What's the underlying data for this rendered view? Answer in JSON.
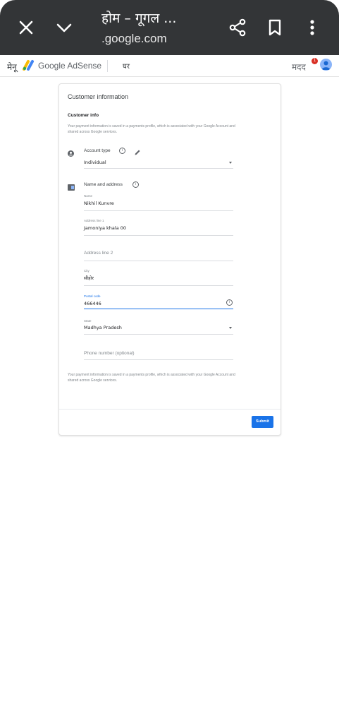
{
  "browser": {
    "title": "होम – गूगल ...",
    "url": ".google.com"
  },
  "appbar": {
    "menu_label": "मेनू",
    "logo_text": "Google AdSense",
    "home_label": "घर",
    "help_label": "मदद",
    "notification_count": "1"
  },
  "form": {
    "title": "Customer information",
    "subtitle": "Customer info",
    "note_top": "Your payment information is saved in a payments profile, which is associated with your Google Account and shared across Google services.",
    "account_type": {
      "label": "Account type",
      "value": "Individual"
    },
    "name_address": {
      "label": "Name and address",
      "name_label": "Name",
      "name_value": "Nikhil Kunvre",
      "address1_label": "Address line 1",
      "address1_value": "Jamoniya khala 00",
      "address2_placeholder": "Address line 2",
      "city_label": "City",
      "city_value": "सीहोर",
      "postal_label": "Postal code",
      "postal_value": "466446",
      "state_label": "State",
      "state_value": "Madhya Pradesh",
      "phone_placeholder": "Phone number (optional)"
    },
    "note_bottom": "Your payment information is saved in a payments profile, which is associated with your Google Account and shared across Google services.",
    "submit_label": "Submit"
  },
  "colors": {
    "accent": "#1a73e8",
    "topbar": "#333537"
  }
}
